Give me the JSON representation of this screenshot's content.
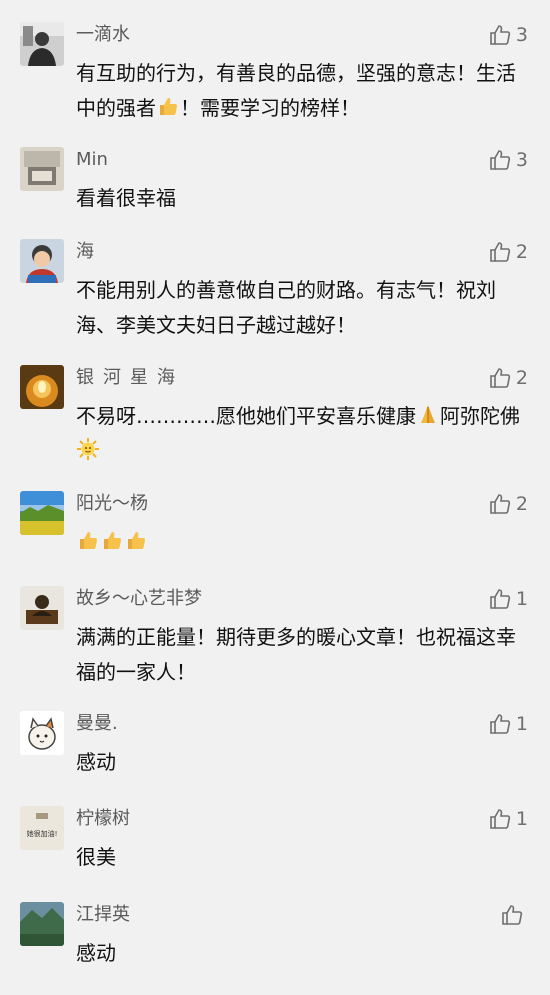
{
  "comments": [
    {
      "name": "一滴水",
      "likes": "3",
      "text_a": "有互助的行为，有善良的品德，坚强的意志！生活中的强者",
      "text_b": "！需要学习的榜样！",
      "emoji": "thumbs-up-emoji"
    },
    {
      "name": "Min",
      "likes": "3",
      "text": "看着很幸福"
    },
    {
      "name": "海",
      "likes": "2",
      "text": "不能用别人的善意做自己的财路。有志气！祝刘海、李美文夫妇日子越过越好！"
    },
    {
      "name": "银 河 星 海",
      "likes": "2",
      "text_a": "不易呀…………愿他她们平安喜乐健康",
      "text_b": "阿弥陀佛",
      "emoji": "praying-hands-emoji",
      "emoji2": "sun-emoji"
    },
    {
      "name": "阳光～杨",
      "likes": "2",
      "emoji": "thumbs-up-emoji"
    },
    {
      "name": "故乡～心艺非梦",
      "likes": "1",
      "text": "满满的正能量！期待更多的暖心文章！也祝福这幸福的一家人！"
    },
    {
      "name": "曼曼.",
      "likes": "1",
      "text": "感动"
    },
    {
      "name": "柠檬树",
      "likes": "1",
      "text": "很美"
    },
    {
      "name": "江捍英",
      "likes": "",
      "text": "感动"
    }
  ],
  "avatar_5_caption": "她很加油!",
  "colors": {
    "background": "#f1f1f1",
    "name": "#5b5b5b",
    "text": "#111111",
    "like": "#6f6f6f"
  }
}
